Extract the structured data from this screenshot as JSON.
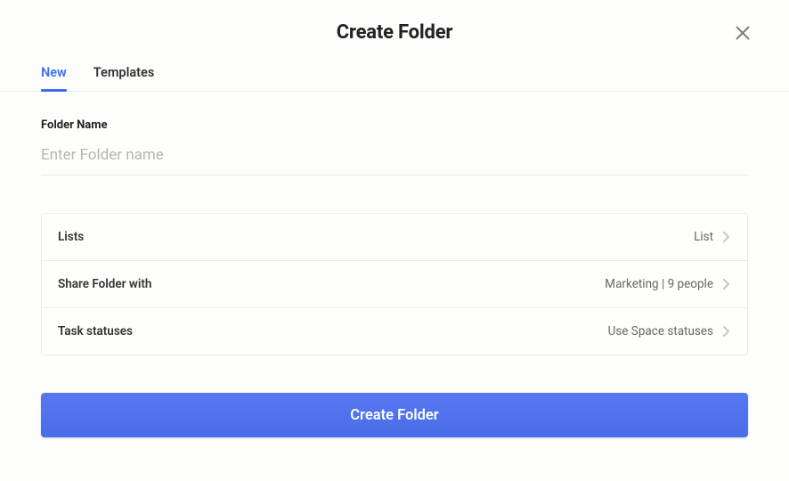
{
  "modal": {
    "title": "Create Folder"
  },
  "tabs": {
    "new": "New",
    "templates": "Templates"
  },
  "folder_name": {
    "label": "Folder Name",
    "placeholder": "Enter Folder name",
    "value": ""
  },
  "rows": {
    "lists": {
      "label": "Lists",
      "value": "List"
    },
    "share": {
      "label": "Share Folder with",
      "value": "Marketing | 9 people"
    },
    "statuses": {
      "label": "Task statuses",
      "value": "Use Space statuses"
    }
  },
  "submit": {
    "label": "Create Folder"
  }
}
